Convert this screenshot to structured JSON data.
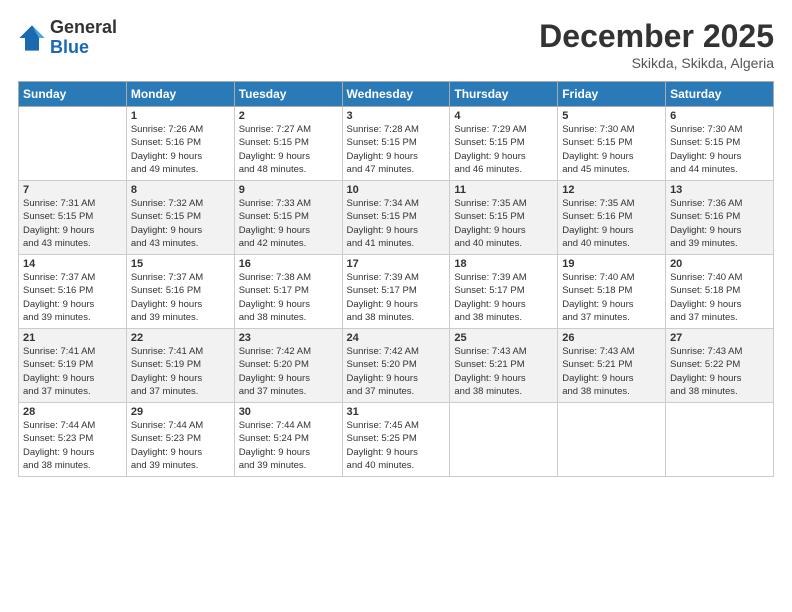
{
  "logo": {
    "general": "General",
    "blue": "Blue"
  },
  "title": "December 2025",
  "subtitle": "Skikda, Skikda, Algeria",
  "days_header": [
    "Sunday",
    "Monday",
    "Tuesday",
    "Wednesday",
    "Thursday",
    "Friday",
    "Saturday"
  ],
  "weeks": [
    [
      {
        "day": "",
        "info": ""
      },
      {
        "day": "1",
        "info": "Sunrise: 7:26 AM\nSunset: 5:16 PM\nDaylight: 9 hours\nand 49 minutes."
      },
      {
        "day": "2",
        "info": "Sunrise: 7:27 AM\nSunset: 5:15 PM\nDaylight: 9 hours\nand 48 minutes."
      },
      {
        "day": "3",
        "info": "Sunrise: 7:28 AM\nSunset: 5:15 PM\nDaylight: 9 hours\nand 47 minutes."
      },
      {
        "day": "4",
        "info": "Sunrise: 7:29 AM\nSunset: 5:15 PM\nDaylight: 9 hours\nand 46 minutes."
      },
      {
        "day": "5",
        "info": "Sunrise: 7:30 AM\nSunset: 5:15 PM\nDaylight: 9 hours\nand 45 minutes."
      },
      {
        "day": "6",
        "info": "Sunrise: 7:30 AM\nSunset: 5:15 PM\nDaylight: 9 hours\nand 44 minutes."
      }
    ],
    [
      {
        "day": "7",
        "info": "Sunrise: 7:31 AM\nSunset: 5:15 PM\nDaylight: 9 hours\nand 43 minutes."
      },
      {
        "day": "8",
        "info": "Sunrise: 7:32 AM\nSunset: 5:15 PM\nDaylight: 9 hours\nand 43 minutes."
      },
      {
        "day": "9",
        "info": "Sunrise: 7:33 AM\nSunset: 5:15 PM\nDaylight: 9 hours\nand 42 minutes."
      },
      {
        "day": "10",
        "info": "Sunrise: 7:34 AM\nSunset: 5:15 PM\nDaylight: 9 hours\nand 41 minutes."
      },
      {
        "day": "11",
        "info": "Sunrise: 7:35 AM\nSunset: 5:15 PM\nDaylight: 9 hours\nand 40 minutes."
      },
      {
        "day": "12",
        "info": "Sunrise: 7:35 AM\nSunset: 5:16 PM\nDaylight: 9 hours\nand 40 minutes."
      },
      {
        "day": "13",
        "info": "Sunrise: 7:36 AM\nSunset: 5:16 PM\nDaylight: 9 hours\nand 39 minutes."
      }
    ],
    [
      {
        "day": "14",
        "info": "Sunrise: 7:37 AM\nSunset: 5:16 PM\nDaylight: 9 hours\nand 39 minutes."
      },
      {
        "day": "15",
        "info": "Sunrise: 7:37 AM\nSunset: 5:16 PM\nDaylight: 9 hours\nand 39 minutes."
      },
      {
        "day": "16",
        "info": "Sunrise: 7:38 AM\nSunset: 5:17 PM\nDaylight: 9 hours\nand 38 minutes."
      },
      {
        "day": "17",
        "info": "Sunrise: 7:39 AM\nSunset: 5:17 PM\nDaylight: 9 hours\nand 38 minutes."
      },
      {
        "day": "18",
        "info": "Sunrise: 7:39 AM\nSunset: 5:17 PM\nDaylight: 9 hours\nand 38 minutes."
      },
      {
        "day": "19",
        "info": "Sunrise: 7:40 AM\nSunset: 5:18 PM\nDaylight: 9 hours\nand 37 minutes."
      },
      {
        "day": "20",
        "info": "Sunrise: 7:40 AM\nSunset: 5:18 PM\nDaylight: 9 hours\nand 37 minutes."
      }
    ],
    [
      {
        "day": "21",
        "info": "Sunrise: 7:41 AM\nSunset: 5:19 PM\nDaylight: 9 hours\nand 37 minutes."
      },
      {
        "day": "22",
        "info": "Sunrise: 7:41 AM\nSunset: 5:19 PM\nDaylight: 9 hours\nand 37 minutes."
      },
      {
        "day": "23",
        "info": "Sunrise: 7:42 AM\nSunset: 5:20 PM\nDaylight: 9 hours\nand 37 minutes."
      },
      {
        "day": "24",
        "info": "Sunrise: 7:42 AM\nSunset: 5:20 PM\nDaylight: 9 hours\nand 37 minutes."
      },
      {
        "day": "25",
        "info": "Sunrise: 7:43 AM\nSunset: 5:21 PM\nDaylight: 9 hours\nand 38 minutes."
      },
      {
        "day": "26",
        "info": "Sunrise: 7:43 AM\nSunset: 5:21 PM\nDaylight: 9 hours\nand 38 minutes."
      },
      {
        "day": "27",
        "info": "Sunrise: 7:43 AM\nSunset: 5:22 PM\nDaylight: 9 hours\nand 38 minutes."
      }
    ],
    [
      {
        "day": "28",
        "info": "Sunrise: 7:44 AM\nSunset: 5:23 PM\nDaylight: 9 hours\nand 38 minutes."
      },
      {
        "day": "29",
        "info": "Sunrise: 7:44 AM\nSunset: 5:23 PM\nDaylight: 9 hours\nand 39 minutes."
      },
      {
        "day": "30",
        "info": "Sunrise: 7:44 AM\nSunset: 5:24 PM\nDaylight: 9 hours\nand 39 minutes."
      },
      {
        "day": "31",
        "info": "Sunrise: 7:45 AM\nSunset: 5:25 PM\nDaylight: 9 hours\nand 40 minutes."
      },
      {
        "day": "",
        "info": ""
      },
      {
        "day": "",
        "info": ""
      },
      {
        "day": "",
        "info": ""
      }
    ]
  ]
}
